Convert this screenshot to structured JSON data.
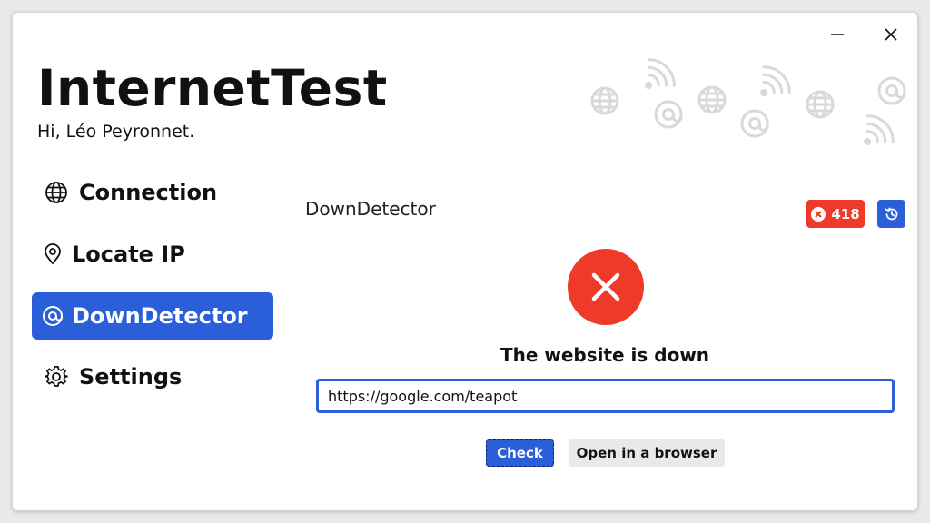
{
  "app": {
    "title": "InternetTest",
    "greeting": "Hi, Léo Peyronnet."
  },
  "window_controls": {
    "minimize_icon": "minimize-icon",
    "close_icon": "close-icon"
  },
  "sidebar": {
    "items": [
      {
        "label": "Connection",
        "icon": "globe-icon",
        "active": false
      },
      {
        "label": "Locate IP",
        "icon": "map-pin-icon",
        "active": false
      },
      {
        "label": "DownDetector",
        "icon": "at-icon",
        "active": true
      },
      {
        "label": "Settings",
        "icon": "gear-icon",
        "active": false
      }
    ]
  },
  "main": {
    "section_title": "DownDetector",
    "status_code": "418",
    "status_text": "The website is down",
    "url_value": "https://google.com/teapot",
    "check_label": "Check",
    "open_browser_label": "Open in a browser"
  },
  "colors": {
    "accent": "#2b5fd9",
    "error": "#ef3a2a",
    "decor": "#dcdcdc"
  }
}
